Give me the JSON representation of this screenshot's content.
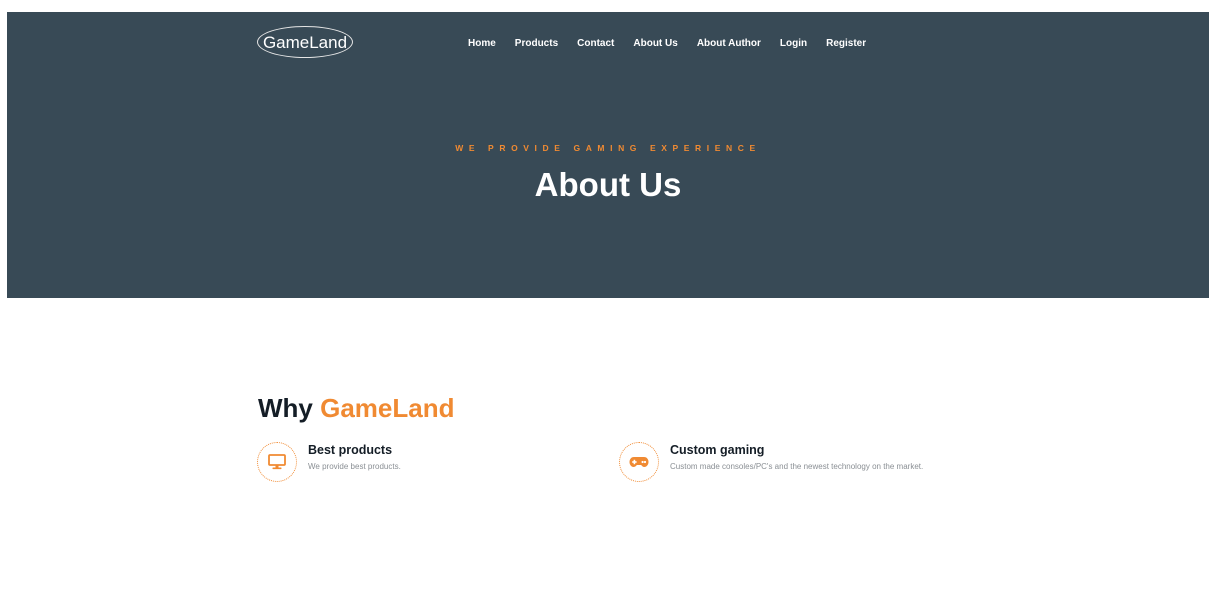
{
  "brand": {
    "logo_text": "GameLand"
  },
  "nav": {
    "items": [
      "Home",
      "Products",
      "Contact",
      "About Us",
      "About Author",
      "Login",
      "Register"
    ]
  },
  "hero": {
    "tagline": "WE PROVIDE GAMING EXPERIENCE",
    "title": "About Us"
  },
  "why": {
    "title_prefix": "Why",
    "title_accent": "GameLand"
  },
  "features": [
    {
      "icon": "monitor-icon",
      "title": "Best products",
      "description": "We provide best products."
    },
    {
      "icon": "gamepad-icon",
      "title": "Custom gaming",
      "description": "Custom made consoles/PC's and the newest technology on the market."
    }
  ],
  "colors": {
    "hero_bg": "#384a56",
    "accent": "#f08a32",
    "heading": "#141d26",
    "muted_text": "#8a8f94"
  }
}
